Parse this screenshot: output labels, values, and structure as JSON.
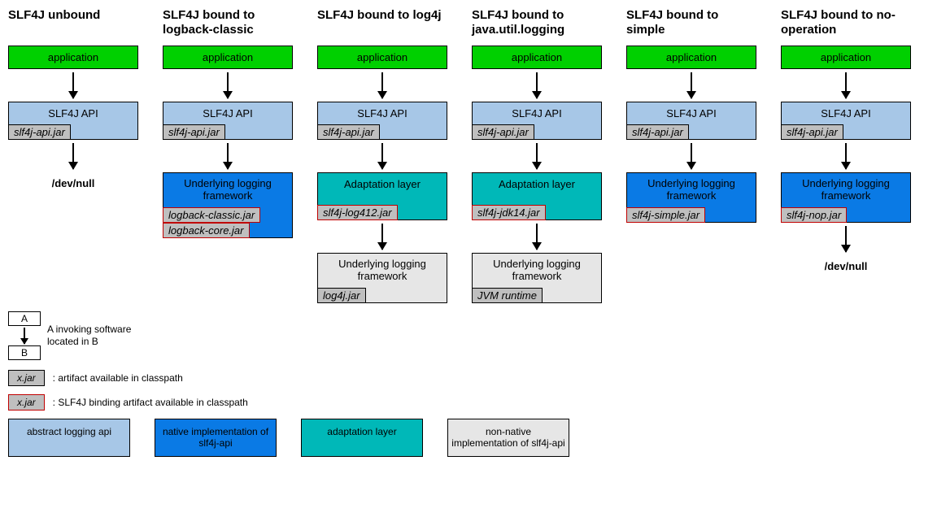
{
  "columns": [
    {
      "title": "SLF4J unbound",
      "app": "application",
      "api_label": "SLF4J API",
      "api_jar": "slf4j-api.jar",
      "terminal": "/dev/null"
    },
    {
      "title": "SLF4J bound to logback-classic",
      "app": "application",
      "api_label": "SLF4J API",
      "api_jar": "slf4j-api.jar",
      "native_label": "Underlying logging framework",
      "native_jar_a": "logback-classic.jar",
      "native_jar_b": "logback-core.jar"
    },
    {
      "title": "SLF4J bound to log4j",
      "app": "application",
      "api_label": "SLF4J API",
      "api_jar": "slf4j-api.jar",
      "adapt_label": "Adaptation layer",
      "adapt_jar": "slf4j-log412.jar",
      "fw_label": "Underlying logging framework",
      "fw_jar": "log4j.jar"
    },
    {
      "title": "SLF4J bound to java.util.logging",
      "app": "application",
      "api_label": "SLF4J API",
      "api_jar": "slf4j-api.jar",
      "adapt_label": "Adaptation layer",
      "adapt_jar": "slf4j-jdk14.jar",
      "fw_label": "Underlying logging framework",
      "fw_jar": "JVM runtime"
    },
    {
      "title": "SLF4J bound to simple",
      "app": "application",
      "api_label": "SLF4J API",
      "api_jar": "slf4j-api.jar",
      "native_label": "Underlying logging framework",
      "native_jar_a": "slf4j-simple.jar"
    },
    {
      "title": "SLF4J bound to no-operation",
      "app": "application",
      "api_label": "SLF4J API",
      "api_jar": "slf4j-api.jar",
      "native_label": "Underlying logging framework",
      "native_jar_a": "slf4j-nop.jar",
      "terminal": "/dev/null"
    }
  ],
  "legend": {
    "ab_a": "A",
    "ab_b": "B",
    "ab_text": "A invoking software located in B",
    "xjar": "x.jar",
    "xjar_text": ": artifact available in classpath",
    "xjar_red_text": ": SLF4J binding artifact available in classpath",
    "clr_api": "abstract logging api",
    "clr_native": "native implementation of slf4j-api",
    "clr_adapt": "adaptation layer",
    "clr_nonnative": "non-native implementation of slf4j-api"
  }
}
